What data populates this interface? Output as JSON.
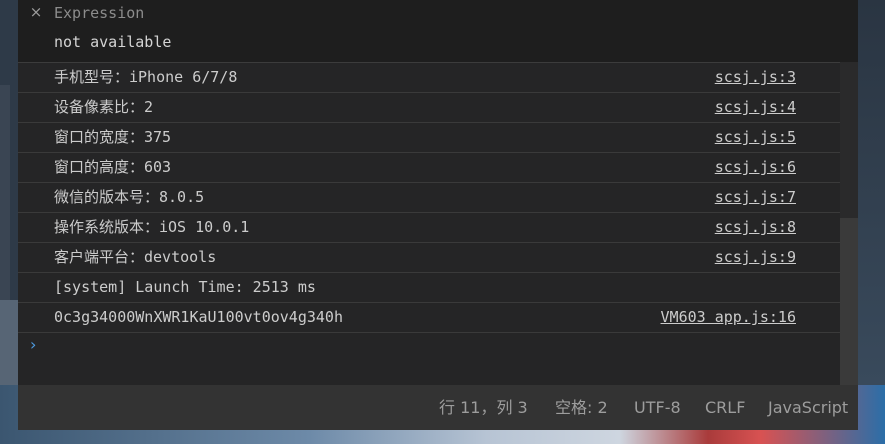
{
  "expression": {
    "close_icon": "×",
    "label": "Expression",
    "value": "not available"
  },
  "console": {
    "rows": [
      {
        "message": "手机型号：iPhone 6/7/8",
        "source": "scsj.js:3"
      },
      {
        "message": "设备像素比：2",
        "source": "scsj.js:4"
      },
      {
        "message": "窗口的宽度：375",
        "source": "scsj.js:5"
      },
      {
        "message": "窗口的高度：603",
        "source": "scsj.js:6"
      },
      {
        "message": "微信的版本号：8.0.5",
        "source": "scsj.js:7"
      },
      {
        "message": "操作系统版本：iOS 10.0.1",
        "source": "scsj.js:8"
      },
      {
        "message": "客户端平台：devtools",
        "source": "scsj.js:9"
      },
      {
        "message": "[system] Launch Time: 2513 ms",
        "source": ""
      },
      {
        "message": "0c3g34000WnXWR1KaU100vt0ov4g340h",
        "source": "VM603 app.js:16"
      }
    ],
    "prompt_icon": "›"
  },
  "statusbar": {
    "position": "行 11，列 3",
    "indent": "空格: 2",
    "encoding": "UTF-8",
    "line_ending": "CRLF",
    "language": "JavaScript"
  },
  "colors": {
    "panel_bg": "#252526",
    "expression_bg": "#1e1e1e",
    "statusbar_bg": "#333333",
    "prompt_accent": "#4d9be0"
  }
}
